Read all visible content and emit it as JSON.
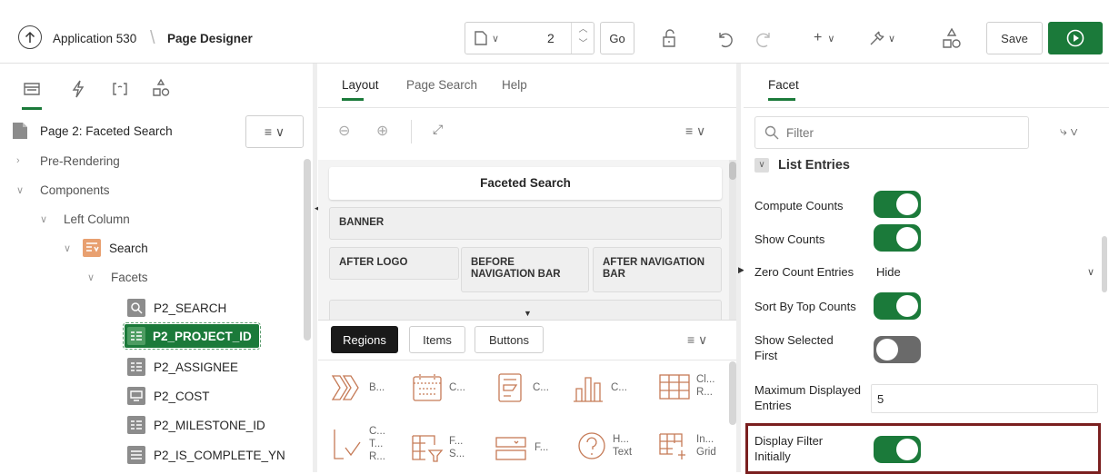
{
  "toolbar": {
    "app_name": "Application 530",
    "separator": "\\",
    "page_designer": "Page Designer",
    "page_number": "2",
    "go_label": "Go",
    "save_label": "Save"
  },
  "left_panel": {
    "page_title": "Page 2: Faceted Search",
    "tree": {
      "pre_rendering": "Pre-Rendering",
      "components": "Components",
      "left_column": "Left Column",
      "search": "Search",
      "facets": "Facets",
      "items": [
        "P2_SEARCH",
        "P2_PROJECT_ID",
        "P2_ASSIGNEE",
        "P2_COST",
        "P2_MILESTONE_ID",
        "P2_IS_COMPLETE_YN"
      ]
    }
  },
  "middle_panel": {
    "tabs": [
      "Layout",
      "Page Search",
      "Help"
    ],
    "faceted_search": "Faceted Search",
    "banner": "BANNER",
    "after_logo": "AFTER LOGO",
    "before_nav": "BEFORE NAVIGATION BAR",
    "after_nav": "AFTER NAVIGATION BAR",
    "gallery_tabs": [
      "Regions",
      "Items",
      "Buttons"
    ],
    "gallery_row1": [
      "B...",
      "C...",
      "C...",
      "C...",
      "Cl...\nR..."
    ],
    "gallery_row2": [
      "C...\nT...\nR...",
      "F...\nS...",
      "F...",
      "H...\nText",
      "In...\nGrid"
    ]
  },
  "right_panel": {
    "tab": "Facet",
    "filter_placeholder": "Filter",
    "section": "List Entries",
    "compute_counts": "Compute Counts",
    "show_counts": "Show Counts",
    "zero_count_entries": "Zero Count Entries",
    "zero_count_value": "Hide",
    "sort_by_top_counts": "Sort By Top Counts",
    "show_selected_first": "Show Selected First",
    "maximum_displayed_entries": "Maximum Displayed Entries",
    "maximum_value": "5",
    "display_filter_initially": "Display Filter Initially"
  },
  "colors": {
    "accent": "#1b7a3a",
    "highlight_border": "#7a1f1f",
    "icon_orange": "#c57a56"
  }
}
